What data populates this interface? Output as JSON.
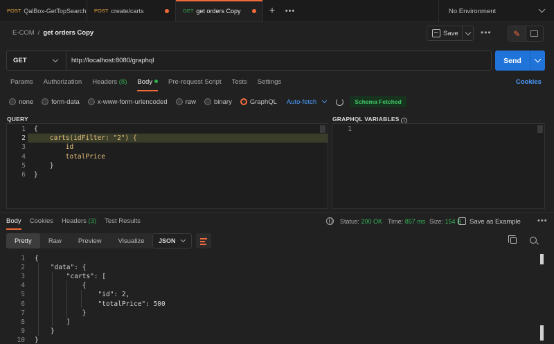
{
  "tabs": [
    {
      "method": "POST",
      "title": "QalBox-GetTopSearches",
      "state": "none"
    },
    {
      "method": "POST",
      "title": "create/carts",
      "state": "unsaved"
    },
    {
      "method": "GET",
      "title": "get orders Copy",
      "state": "active"
    }
  ],
  "environment": "No Environment",
  "breadcrumb": {
    "collection": "E-COM",
    "separator": "/",
    "request": "get orders Copy"
  },
  "header_actions": {
    "save_label": "Save"
  },
  "request": {
    "method": "GET",
    "url": "http://localhost:8080/graphql",
    "send_label": "Send"
  },
  "request_tabs": [
    {
      "label": "Params"
    },
    {
      "label": "Authorization"
    },
    {
      "label": "Headers",
      "count": "(8)"
    },
    {
      "label": "Body",
      "active": true
    },
    {
      "label": "Pre-request Script"
    },
    {
      "label": "Tests"
    },
    {
      "label": "Settings"
    }
  ],
  "cookies_link": "Cookies",
  "body_types": [
    "none",
    "form-data",
    "x-www-form-urlencoded",
    "raw",
    "binary",
    "GraphQL"
  ],
  "body_selected": "GraphQL",
  "auto_fetch": "Auto-fetch",
  "schema_badge": "Schema Fetched",
  "query_panel": {
    "label": "QUERY",
    "lines": [
      {
        "n": "1",
        "text": "{"
      },
      {
        "n": "2",
        "text": "    carts(idFilter: \"2\") {"
      },
      {
        "n": "3",
        "text": "        id"
      },
      {
        "n": "4",
        "text": "        totalPrice"
      },
      {
        "n": "5",
        "text": "    }"
      },
      {
        "n": "6",
        "text": "}"
      }
    ]
  },
  "variables_panel": {
    "label": "GRAPHQL VARIABLES",
    "lines": [
      {
        "n": "1",
        "text": ""
      }
    ]
  },
  "response_tabs": [
    {
      "label": "Body",
      "active": true
    },
    {
      "label": "Cookies"
    },
    {
      "label": "Headers",
      "count": "(3)"
    },
    {
      "label": "Test Results"
    }
  ],
  "response_status": {
    "status_label": "Status:",
    "status_value": "200 OK",
    "time_label": "Time:",
    "time_value": "857 ms",
    "size_label": "Size:",
    "size_value": "154 B",
    "save_example": "Save as Example"
  },
  "view_modes": [
    "Pretty",
    "Raw",
    "Preview",
    "Visualize"
  ],
  "format": "JSON",
  "response_lines": [
    {
      "n": "1",
      "text": "{"
    },
    {
      "n": "2",
      "text": "    \"data\": {"
    },
    {
      "n": "3",
      "text": "        \"carts\": ["
    },
    {
      "n": "4",
      "text": "            {"
    },
    {
      "n": "5",
      "text": "                \"id\": 2,"
    },
    {
      "n": "6",
      "text": "                \"totalPrice\": 500"
    },
    {
      "n": "7",
      "text": "            }"
    },
    {
      "n": "8",
      "text": "        ]"
    },
    {
      "n": "9",
      "text": "    }"
    },
    {
      "n": "10",
      "text": "}"
    }
  ],
  "colors": {
    "accent": "#f26b3a",
    "send": "#1f73d9",
    "success": "#36b55a",
    "link": "#4a9eff"
  }
}
